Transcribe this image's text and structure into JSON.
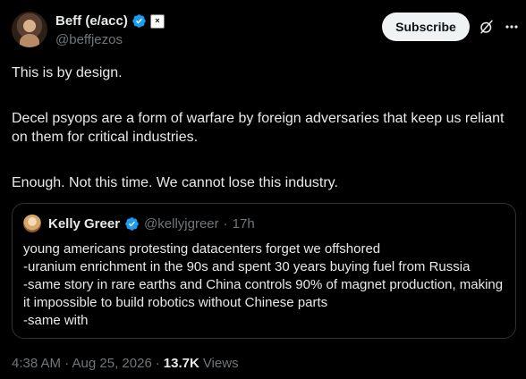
{
  "author": {
    "name": "Beff (e/acc)",
    "handle": "@beffjezos",
    "affiliate_badge": "×"
  },
  "actions": {
    "subscribe_label": "Subscribe"
  },
  "tweet": {
    "paragraphs": [
      "This is by design.",
      "Decel psyops are a form of warfare by foreign adversaries that keep us reliant on them for critical industries.",
      "Enough. Not this time. We cannot lose this industry."
    ],
    "timestamp": "4:38 AM · Aug 25, 2026",
    "separator": "·",
    "views_count": "13.7K",
    "views_label": "Views"
  },
  "quote": {
    "name": "Kelly Greer",
    "handle": "@kellyjgreer",
    "dot": "·",
    "age": "17h",
    "lines": [
      "young americans protesting datacenters forget we offshored",
      "-uranium enrichment in the 90s and spent 30 years buying fuel from Russia",
      "-same story in rare earths and China controls 90% of magnet production, making it impossible to build robotics without Chinese parts",
      "-same with"
    ]
  },
  "colors": {
    "background": "#000000",
    "text": "#e7e9ea",
    "muted": "#71767b",
    "verified": "#1d9bf0",
    "border": "#2f3336"
  }
}
